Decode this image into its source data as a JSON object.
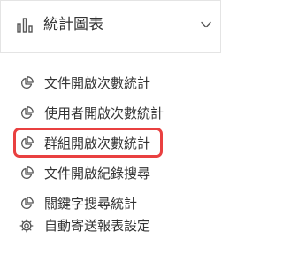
{
  "header": {
    "title": "統計圖表",
    "icon": "bar-chart-icon",
    "toggle_icon": "chevron-down-icon"
  },
  "menu": {
    "items": [
      {
        "label": "文件開啟次數統計",
        "icon": "pie-chart-icon"
      },
      {
        "label": "使用者開啟次數統計",
        "icon": "pie-chart-icon"
      },
      {
        "label": "群組開啟次數統計",
        "icon": "pie-chart-icon",
        "highlighted": true
      },
      {
        "label": "文件開啟紀錄搜尋",
        "icon": "pie-chart-icon"
      },
      {
        "label": "關鍵字搜尋統計",
        "icon": "pie-chart-icon"
      },
      {
        "label": "自動寄送報表設定",
        "icon": "gear-icon"
      }
    ]
  },
  "colors": {
    "highlight_border": "#e94040",
    "text": "#333333",
    "icon": "#555555"
  }
}
